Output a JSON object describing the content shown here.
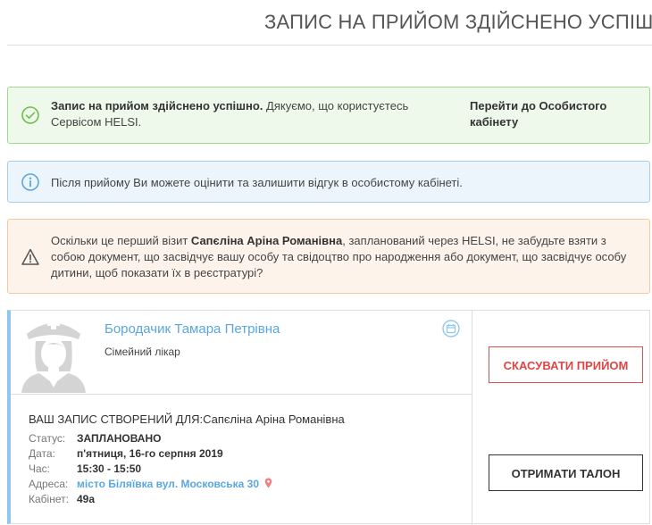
{
  "header": {
    "title": "ЗАПИС НА ПРИЙОМ ЗДІЙСНЕНО УСПІШНО"
  },
  "alerts": {
    "success": {
      "icon": "check-circle-icon",
      "bold": "Запис на прийом здійснено успішно.",
      "text": " Дякуємо, що користуєтесь Сервісом HELSI.",
      "link": "Перейти до Особистого кабінету"
    },
    "info": {
      "icon": "info-circle-icon",
      "text": "Після прийому Ви можете оцінити та залишити відгук в особистому кабінеті."
    },
    "warning": {
      "icon": "warning-triangle-icon",
      "text_before": "Оскільки це перший візит ",
      "patient": "Сапєліна Аріна Романівна",
      "text_after": ", запланований через HELSI, не забудьте взяти з собою документ, що засвідчує вашу особу та свідоцтво про народження або документ, що засвідчує особу дитини, щоб показати їх в реєстратурі?"
    }
  },
  "appointment": {
    "doctor_name": "Бородачик Тамара Петрівна",
    "doctor_role": "Сімейний лікар",
    "created_for": "ВАШ ЗАПИС СТВОРЕНИЙ ДЛЯ:Сапєліна Аріна Романівна",
    "status_label": "Статус:",
    "status_value": "ЗАПЛАНОВАНО",
    "date_label": "Дата:",
    "date_value": "п'ятниця, 16-го серпня 2019",
    "time_label": "Час:",
    "time_value": "15:30 - 15:50",
    "address_label": "Адреса:",
    "address_value": "місто Біляївка вул. Московська 30",
    "cabinet_label": "Кабінет:",
    "cabinet_value": "49а",
    "cancel_button": "СКАСУВАТИ ПРИЙОМ",
    "ticket_button": "ОТРИМАТИ ТАЛОН"
  },
  "colors": {
    "success_border": "#9fd98c",
    "info_border": "#a9cde9",
    "warning_border": "#f2c9a1",
    "link_blue": "#5aa7e0",
    "danger_red": "#e04545"
  }
}
